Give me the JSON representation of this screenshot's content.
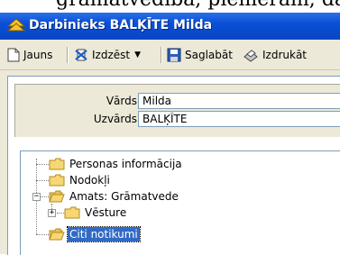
{
  "top_text": "grāmatvedība, piemēram, dar",
  "window": {
    "title": "Darbinieks BALĶĪTE Milda",
    "title_icon": "app-icon",
    "colors": {
      "titlebar": "#0a4fd6",
      "face": "#ece9d8",
      "selection": "#316ac5"
    }
  },
  "toolbar": {
    "new_label": "Jauns",
    "delete_label": "Izdzēst",
    "save_label": "Saglabāt",
    "print_label": "Izdrukāt"
  },
  "form": {
    "first_name_label": "Vārds",
    "first_name_value": "Milda",
    "last_name_label": "Uzvārds",
    "last_name_value": "BALĶĪTE"
  },
  "tree": {
    "items": [
      {
        "label": "Personas informācija",
        "icon": "folder-closed-icon"
      },
      {
        "label": "Nodokļi",
        "icon": "folder-closed-icon"
      },
      {
        "label": "Amats: Grāmatvede",
        "icon": "folder-open-icon",
        "expanded": true
      },
      {
        "label": "Vēsture",
        "icon": "folder-closed-icon",
        "collapsed": true
      },
      {
        "label": "Citi notikumi",
        "icon": "folder-open-icon",
        "selected": true
      }
    ]
  }
}
